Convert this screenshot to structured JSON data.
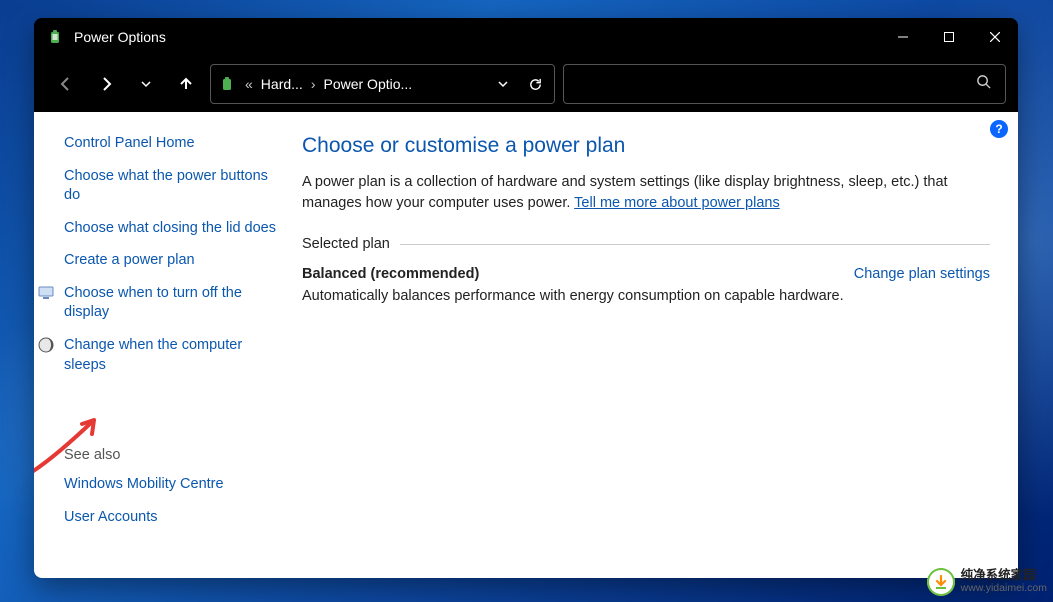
{
  "window": {
    "title": "Power Options"
  },
  "breadcrumb": {
    "chevrons": "«",
    "crumb1": "Hard...",
    "crumb2": "Power Optio..."
  },
  "sidebar": {
    "home": "Control Panel Home",
    "links": [
      {
        "label": "Choose what the power buttons do"
      },
      {
        "label": "Choose what closing the lid does"
      },
      {
        "label": "Create a power plan"
      },
      {
        "label": "Choose when to turn off the display",
        "icon": "display"
      },
      {
        "label": "Change when the computer sleeps",
        "icon": "moon"
      }
    ],
    "see_also_label": "See also",
    "see_also": [
      {
        "label": "Windows Mobility Centre"
      },
      {
        "label": "User Accounts"
      }
    ]
  },
  "main": {
    "heading": "Choose or customise a power plan",
    "description": "A power plan is a collection of hardware and system settings (like display brightness, sleep, etc.) that manages how your computer uses power. ",
    "more_link": "Tell me more about power plans",
    "selected_label": "Selected plan",
    "plan": {
      "name": "Balanced (recommended)",
      "change": "Change plan settings",
      "description": "Automatically balances performance with energy consumption on capable hardware."
    }
  },
  "help_tooltip": "?",
  "watermark": {
    "line1": "纯净系统家园",
    "line2": "www.yidaimei.com"
  }
}
